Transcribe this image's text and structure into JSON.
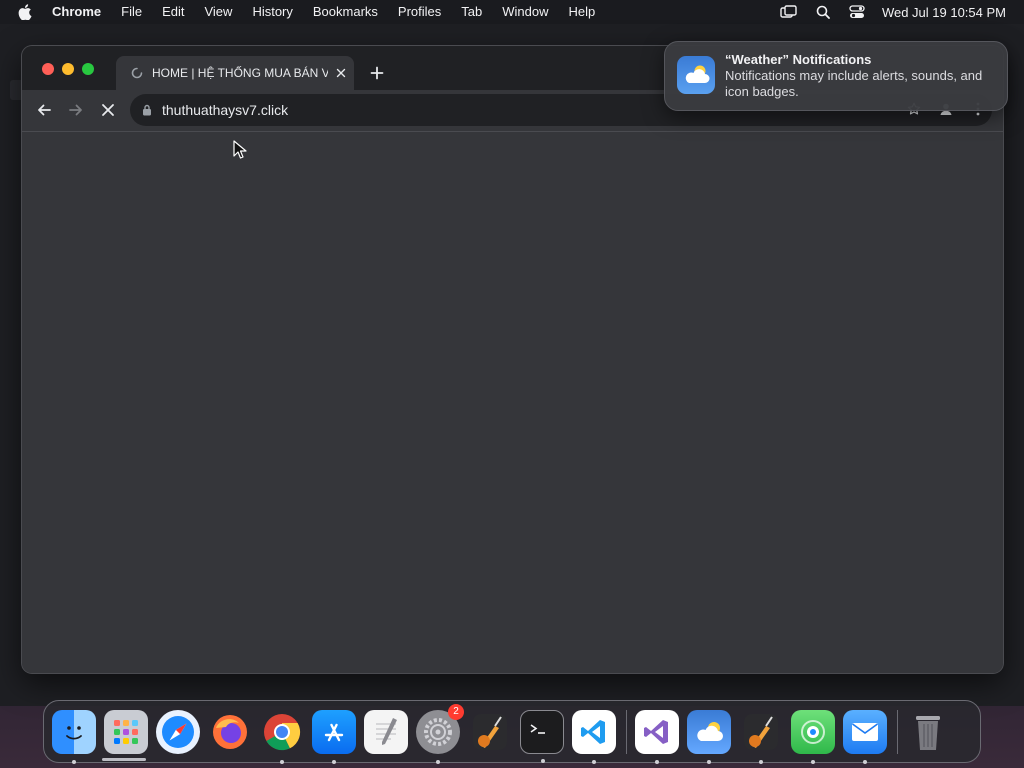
{
  "menubar": {
    "app_name": "Chrome",
    "items": [
      "File",
      "Edit",
      "View",
      "History",
      "Bookmarks",
      "Profiles",
      "Tab",
      "Window",
      "Help"
    ],
    "clock": "Wed Jul 19  10:54 PM",
    "status_icons": [
      "screen-mirror-icon",
      "spotlight-search-icon",
      "control-center-icon"
    ]
  },
  "browser": {
    "tab_title": "HOME | HỆ THỐNG MUA BÁN V",
    "url": "thuthuathaysv7.click",
    "accent": "#8ab4f8"
  },
  "notification": {
    "title": "“Weather” Notifications",
    "body": "Notifications may include alerts, sounds, and icon badges."
  },
  "dock": {
    "apps": [
      {
        "name": "finder"
      },
      {
        "name": "launchpad"
      },
      {
        "name": "safari"
      },
      {
        "name": "firefox"
      },
      {
        "name": "chrome"
      },
      {
        "name": "app-store"
      },
      {
        "name": "textedit"
      },
      {
        "name": "system-settings",
        "badge": "2"
      },
      {
        "name": "garageband"
      },
      {
        "name": "terminal"
      },
      {
        "name": "vscode"
      },
      {
        "name": "visual-studio"
      },
      {
        "name": "weather"
      },
      {
        "name": "garageband-2"
      },
      {
        "name": "find-my"
      },
      {
        "name": "mail"
      },
      {
        "name": "trash"
      }
    ]
  }
}
